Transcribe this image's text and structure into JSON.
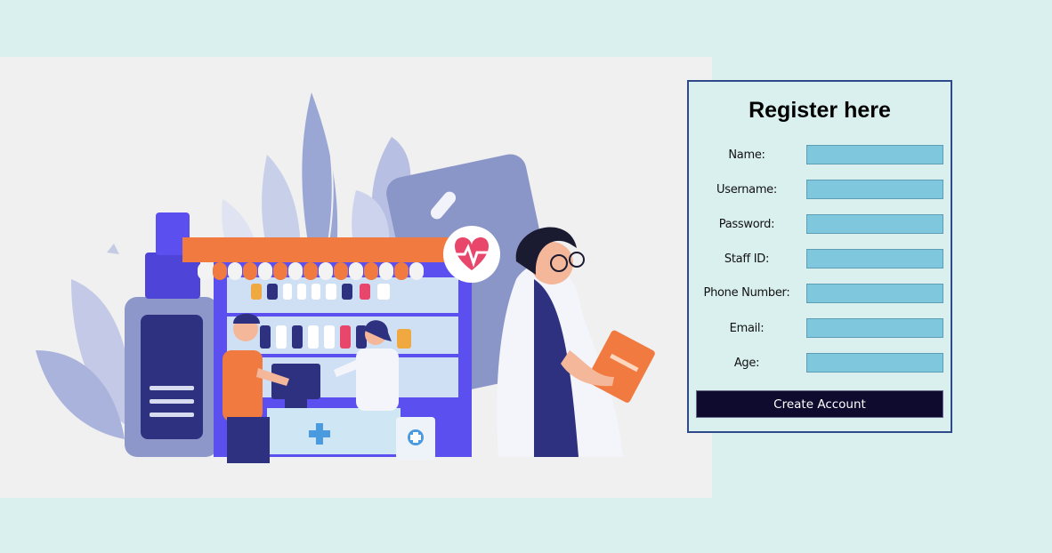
{
  "form": {
    "title": "Register here",
    "fields": [
      {
        "label": "Name:",
        "value": ""
      },
      {
        "label": "Username:",
        "value": ""
      },
      {
        "label": "Password:",
        "value": ""
      },
      {
        "label": "Staff ID:",
        "value": ""
      },
      {
        "label": "Phone Number:",
        "value": ""
      },
      {
        "label": "Email:",
        "value": ""
      },
      {
        "label": "Age:",
        "value": ""
      }
    ],
    "submit_label": "Create Account"
  },
  "illustration": {
    "icon": "pharmacy-illustration",
    "colors": {
      "accent": "#5b4ff0",
      "awning": "#f07a3f",
      "coat": "#ffffff",
      "input_fill": "#7ec7dc",
      "button": "#0e0b2e"
    }
  }
}
